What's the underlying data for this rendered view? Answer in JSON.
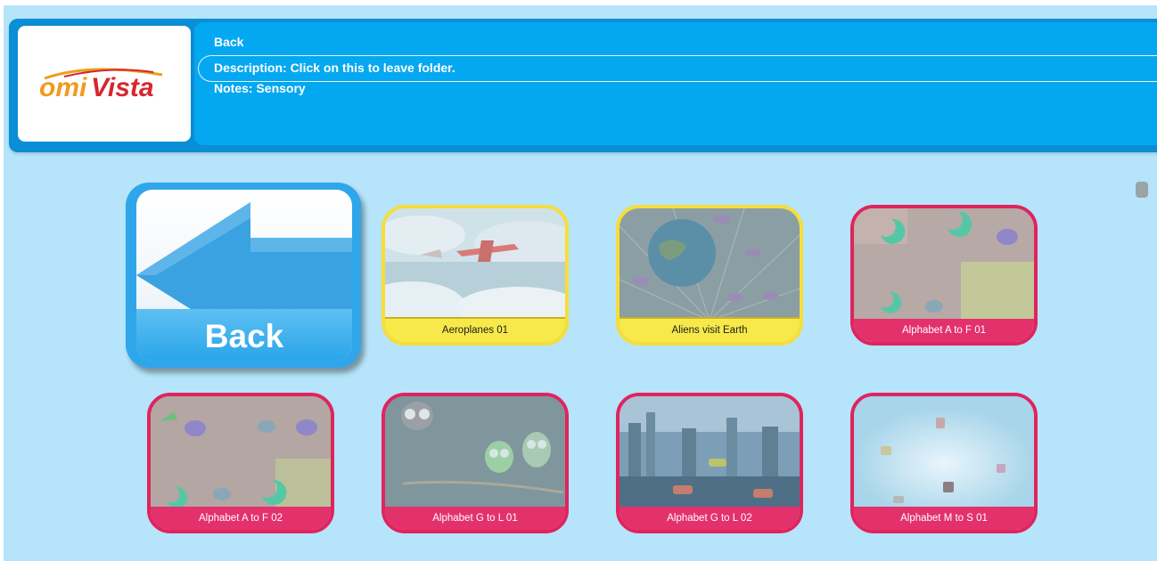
{
  "logo": {
    "text_omi": "omi",
    "text_vista": "Vista"
  },
  "header": {
    "title": "Back",
    "description": "Description: Click on this to leave folder.",
    "notes": "Notes: Sensory"
  },
  "back_tile": {
    "label": "Back",
    "icon": "left-arrow-icon"
  },
  "tiles": [
    {
      "label": "Aeroplanes 01",
      "border": "#f7dd3a",
      "theme": "sky-planes"
    },
    {
      "label": "Aliens visit Earth",
      "border": "#f7dd3a",
      "theme": "space-earth"
    },
    {
      "label": "Alphabet A to F 01",
      "border": "#e0245e",
      "theme": "colorful-moons"
    },
    {
      "label": "Alphabet A to F 02",
      "border": "#e0245e",
      "theme": "colorful-moons"
    },
    {
      "label": "Alphabet G to L 01",
      "border": "#e0245e",
      "theme": "night-owls"
    },
    {
      "label": "Alphabet G to L 02",
      "border": "#e0245e",
      "theme": "city-cars"
    },
    {
      "label": "Alphabet M to S 01",
      "border": "#e0245e",
      "theme": "sky-sparkle"
    }
  ],
  "colors": {
    "background": "#b6e4fa",
    "header_dark": "#0a8ed6",
    "header_light": "#04a8f0",
    "yellow_border": "#f7dd3a",
    "pink_border": "#e0245e"
  }
}
